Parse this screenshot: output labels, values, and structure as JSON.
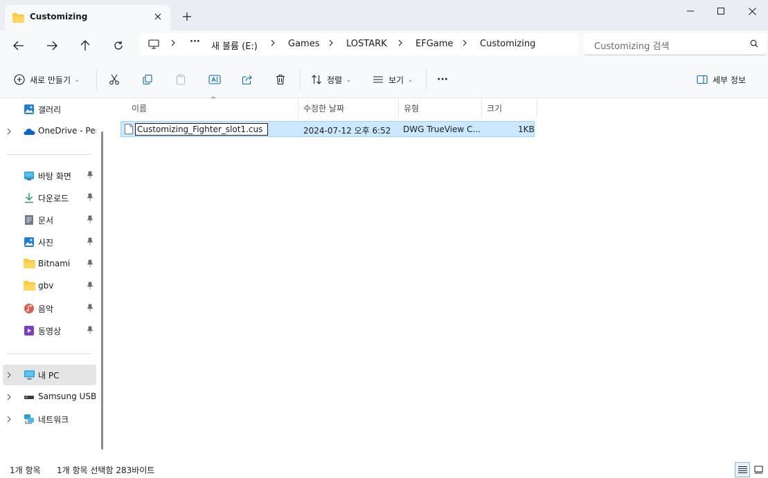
{
  "window": {
    "tab_title": "Customizing",
    "new_tab": "+",
    "minimize": "─",
    "maximize": "☐",
    "close": "✕"
  },
  "address": {
    "breadcrumb": [
      "새 볼륨 (E:)",
      "Games",
      "LOSTARK",
      "EFGame",
      "Customizing"
    ],
    "more": "···"
  },
  "search": {
    "placeholder": "Customizing 검색"
  },
  "commands": {
    "new": "새로 만들기",
    "sort": "정렬",
    "view": "보기",
    "more": "···",
    "details": "세부 정보"
  },
  "sidebar": {
    "top_items": [
      {
        "label": "갤러리",
        "icon": "gallery-icon"
      },
      {
        "label": "OneDrive - Pers",
        "icon": "onedrive-icon"
      }
    ],
    "quick_access": [
      {
        "label": "바탕 화면",
        "icon": "desktop-icon"
      },
      {
        "label": "다운로드",
        "icon": "download-icon"
      },
      {
        "label": "문서",
        "icon": "document-icon"
      },
      {
        "label": "사진",
        "icon": "pictures-icon"
      },
      {
        "label": "Bitnami",
        "icon": "folder-icon"
      },
      {
        "label": "gbv",
        "icon": "folder-icon"
      },
      {
        "label": "음악",
        "icon": "music-icon"
      },
      {
        "label": "동영상",
        "icon": "video-icon"
      }
    ],
    "devices": [
      {
        "label": "내 PC",
        "icon": "pc-icon"
      },
      {
        "label": "Samsung USB (",
        "icon": "usb-drive-icon"
      },
      {
        "label": "네트워크",
        "icon": "network-icon"
      }
    ]
  },
  "columns": [
    "이름",
    "수정한 날짜",
    "유형",
    "크기"
  ],
  "files": [
    {
      "name": "Customizing_Fighter_slot1.cus",
      "modified": "2024-07-12 오후 6:52",
      "type": "DWG TrueView C...",
      "size": "1KB"
    }
  ],
  "status": {
    "count": "1개 항목",
    "selected": "1개 항목 선택함 283바이트"
  },
  "colors": {
    "accent": "#0067c0",
    "selection_bg": "#cce8ff",
    "selection_border": "#99d1ff",
    "folder": "#ffc83d"
  }
}
